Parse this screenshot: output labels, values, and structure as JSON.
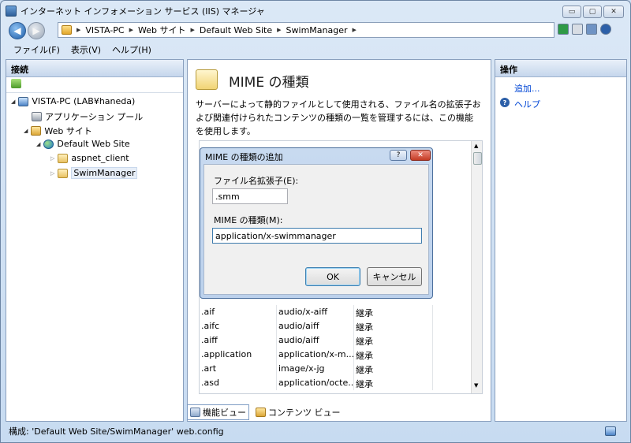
{
  "window": {
    "title": "インターネット インフォメーション サービス (IIS) マネージャ",
    "btn_min": "▭",
    "btn_max": "▢",
    "btn_close": "✕"
  },
  "address": {
    "crumbs": [
      "VISTA-PC",
      "Web サイト",
      "Default Web Site",
      "SwimManager"
    ]
  },
  "menu": [
    "ファイル(F)",
    "表示(V)",
    "ヘルプ(H)"
  ],
  "connections": {
    "header": "接続",
    "tree": [
      {
        "label": "VISTA-PC (LAB¥haneda)",
        "level": 0,
        "icon": "computer-icon"
      },
      {
        "label": "アプリケーション プール",
        "level": 1,
        "icon": "app-pool-icon"
      },
      {
        "label": "Web サイト",
        "level": 1,
        "icon": "sites-folder-icon"
      },
      {
        "label": "Default Web Site",
        "level": 2,
        "icon": "globe-icon"
      },
      {
        "label": "aspnet_client",
        "level": 3,
        "icon": "folder-icon"
      },
      {
        "label": "SwimManager",
        "level": 3,
        "icon": "app-folder-icon"
      }
    ]
  },
  "feature": {
    "title": "MIME の種類",
    "description": "サーバーによって静的ファイルとして使用される、ファイル名の拡張子および関連付けられたコンテンツの種類の一覧を管理するには、この機能を使用します。",
    "rows": [
      {
        "ext": ".aif",
        "mime": "audio/x-aiff",
        "entry": "継承"
      },
      {
        "ext": ".aifc",
        "mime": "audio/aiff",
        "entry": "継承"
      },
      {
        "ext": ".aiff",
        "mime": "audio/aiff",
        "entry": "継承"
      },
      {
        "ext": ".application",
        "mime": "application/x-m...",
        "entry": "継承"
      },
      {
        "ext": ".art",
        "mime": "image/x-jg",
        "entry": "継承"
      },
      {
        "ext": ".asd",
        "mime": "application/octe...",
        "entry": "継承"
      }
    ]
  },
  "bottom_tabs": {
    "features": "機能ビュー",
    "content": "コンテンツ ビュー"
  },
  "actions": {
    "header": "操作",
    "add": "追加...",
    "help": "ヘルプ"
  },
  "status": {
    "text": "構成: 'Default Web Site/SwimManager' web.config"
  },
  "dialog": {
    "title": "MIME の種類の追加",
    "help_btn": "?",
    "close_btn": "✕",
    "ext_label": "ファイル名拡張子(E):",
    "ext_value": ".smm",
    "mime_label": "MIME の種類(M):",
    "mime_value": "application/x-swimmanager",
    "ok": "OK",
    "cancel": "キャンセル"
  }
}
